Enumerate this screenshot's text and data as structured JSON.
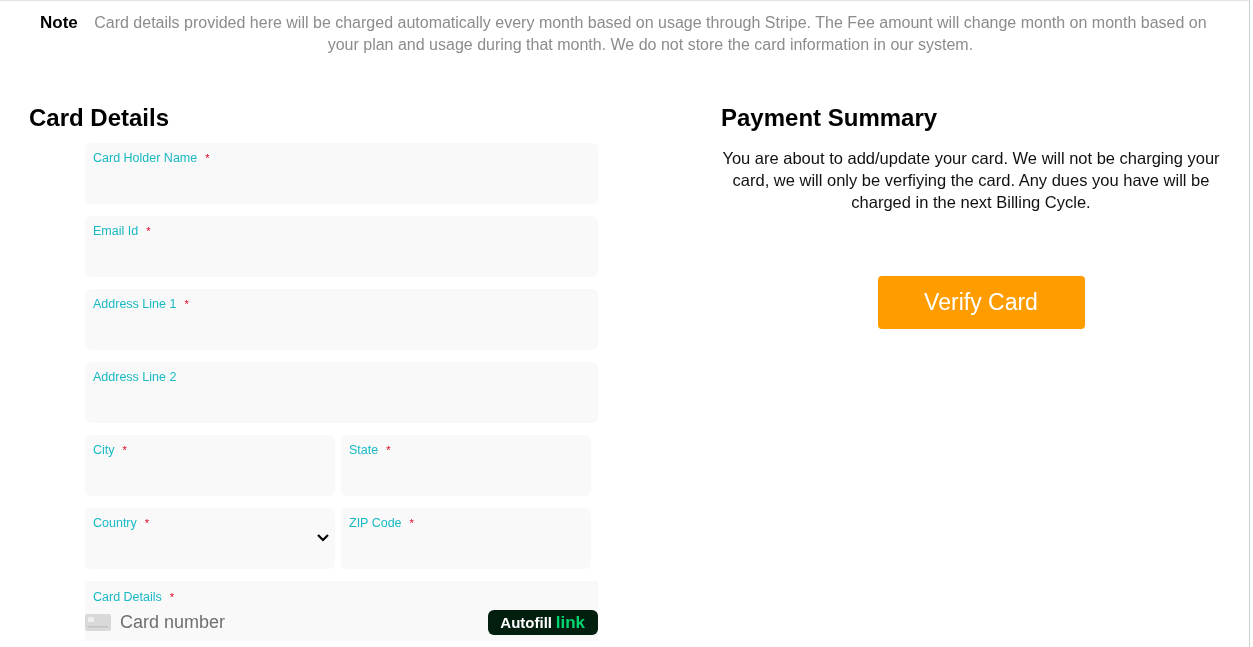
{
  "note": {
    "label": "Note",
    "text": "Card details provided here will be charged automatically every month based on usage through Stripe. The Fee amount will change month on month based on your plan and usage during that month. We do not store the card information in our system."
  },
  "card_details": {
    "title": "Card Details",
    "rows": [
      {
        "fields": [
          {
            "kind": "text",
            "label": "Card Holder Name",
            "required_mark": "*"
          }
        ]
      },
      {
        "fields": [
          {
            "kind": "text",
            "label": "Email Id",
            "required_mark": "*"
          }
        ]
      },
      {
        "fields": [
          {
            "kind": "text",
            "label": "Address Line 1",
            "required_mark": "*"
          }
        ]
      },
      {
        "fields": [
          {
            "kind": "text",
            "label": "Address Line 2"
          }
        ]
      },
      {
        "fields": [
          {
            "kind": "text",
            "label": "City",
            "required_mark": "*"
          },
          {
            "kind": "text",
            "label": "State",
            "required_mark": "*"
          }
        ]
      },
      {
        "fields": [
          {
            "kind": "select",
            "label": "Country",
            "required_mark": "*"
          },
          {
            "kind": "text",
            "label": "ZIP Code",
            "required_mark": "*"
          }
        ]
      },
      {
        "fields": [
          {
            "kind": "card",
            "label": "Card Details",
            "required_mark": "*",
            "placeholder": "Card number",
            "autofill": {
              "label": "Autofill",
              "brand": "link"
            }
          }
        ]
      }
    ]
  },
  "payment_summary": {
    "title": "Payment Summary",
    "text": "You are about to add/update your card. We will not be charging your card, we will only be verfiying the card. Any dues you have will be charged in the next Billing Cycle.",
    "button": "Verify Card"
  }
}
